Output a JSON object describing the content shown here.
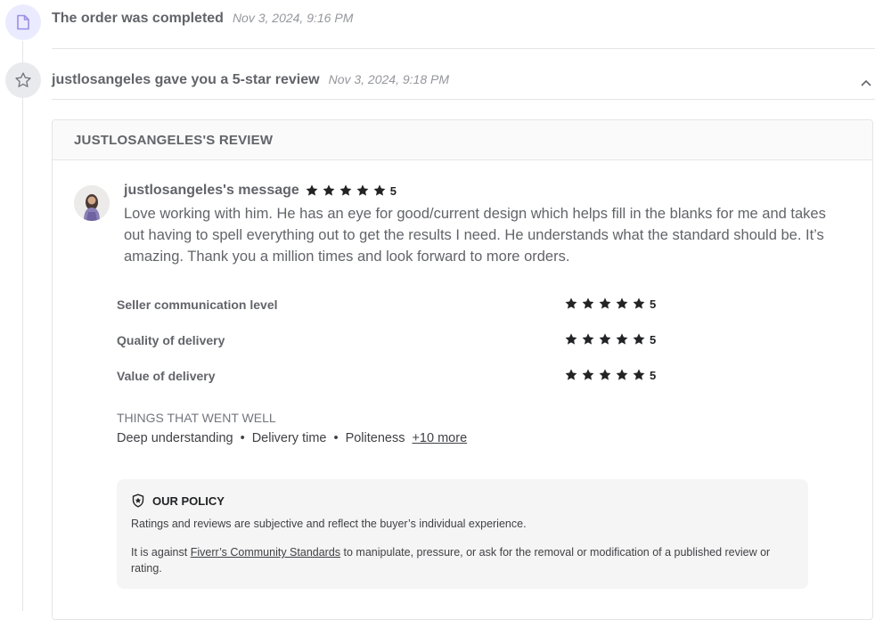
{
  "events": [
    {
      "title": "The order was completed",
      "timestamp": "Nov 3, 2024, 9:16 PM",
      "icon": "document-icon"
    },
    {
      "title": "justlosangeles gave you a 5-star review",
      "timestamp": "Nov 3, 2024, 9:18 PM",
      "icon": "star-outline-icon"
    }
  ],
  "review": {
    "header": "JUSTLOSANGELES'S REVIEW",
    "message_title": "justlosangeles's message",
    "overall_rating": "5",
    "message": "Love working with him. He has an eye for good/current design which helps fill in the blanks for me and takes out having to spell everything out to get the results I need. He understands what the standard should be. It’s amazing. Thank you a million times and look forward to more orders.",
    "criteria": [
      {
        "label": "Seller communication level",
        "rating": "5"
      },
      {
        "label": "Quality of delivery",
        "rating": "5"
      },
      {
        "label": "Value of delivery",
        "rating": "5"
      }
    ],
    "went_well_title": "THINGS THAT WENT WELL",
    "went_well": [
      "Deep understanding",
      "Delivery time",
      "Politeness"
    ],
    "more_link": "+10 more"
  },
  "policy": {
    "title": "OUR POLICY",
    "p1": "Ratings and reviews are subjective and reflect the buyer’s individual experience.",
    "p2_before": "It is against ",
    "p2_link": "Fiverr’s Community Standards",
    "p2_after": " to manipulate, pressure, or ask for the removal or modification of a published review or rating."
  },
  "colors": {
    "star": "#222325",
    "doc_icon": "#9b8ee6",
    "star_icon": "#74767e"
  }
}
